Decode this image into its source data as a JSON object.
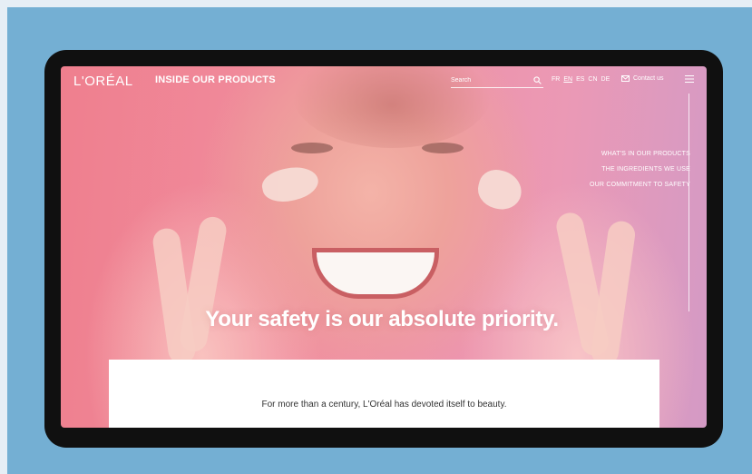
{
  "header": {
    "logo": "L'ORÉAL",
    "product_title": "INSIDE OUR PRODUCTS",
    "search_placeholder": "Search",
    "languages": [
      "FR",
      "EN",
      "ES",
      "CN",
      "DE"
    ],
    "active_language": "EN",
    "contact_label": "Contact us"
  },
  "side_nav": {
    "items": [
      "WHAT'S IN OUR PRODUCTS",
      "THE INGREDIENTS WE USE",
      "OUR COMMITMENT TO SAFETY"
    ]
  },
  "hero": {
    "headline": "Your safety is our absolute priority."
  },
  "content": {
    "intro": "For more than a century, L'Oréal has devoted itself to beauty."
  },
  "colors": {
    "outer_background": "#74afd3",
    "device_frame": "#101010",
    "hero_pink": "#ef7f8e",
    "text_white": "#ffffff"
  },
  "icons": {
    "search": "search-icon",
    "mail": "mail-icon",
    "menu": "hamburger-menu-icon"
  }
}
